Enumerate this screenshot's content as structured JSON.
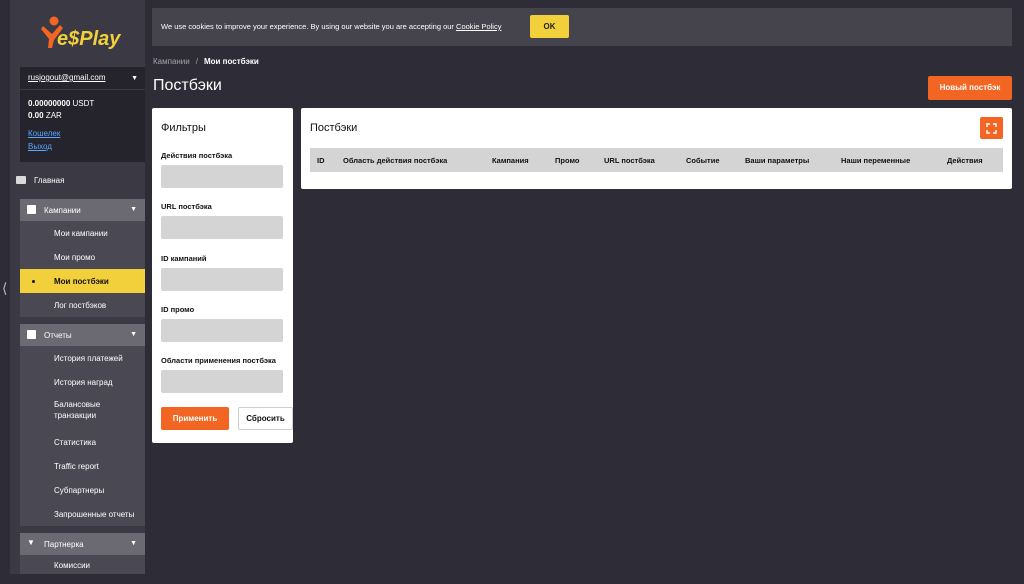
{
  "brand": {
    "logo_text": "Ye$Play",
    "accent": "#f26522",
    "highlight": "#f2d03b"
  },
  "account": {
    "email": "rusjogout@gmail.com",
    "balance_usdt_value": "0.00000000",
    "balance_usdt_currency": "USDT",
    "balance_zar_value": "0.00",
    "balance_zar_currency": "ZAR",
    "wallet_link": "Кошелек",
    "logout_link": "Выход"
  },
  "sidebar": {
    "home": "Главная",
    "campaigns": {
      "label": "Кампании",
      "items": [
        "Мои кампании",
        "Мои промо",
        "Мои постбэки",
        "Лог постбэков"
      ]
    },
    "reports": {
      "label": "Отчеты",
      "items": [
        "История платежей",
        "История наград",
        "Балансовые транзакции",
        "Статистика",
        "Traffic report",
        "Субпартнеры",
        "Запрошенные отчеты"
      ]
    },
    "partner": {
      "label": "Партнерка",
      "items": [
        "Комиссии"
      ]
    }
  },
  "cookie": {
    "text": "We use cookies to improve your experience. By using our website you are accepting our",
    "link": "Cookie Policy",
    "ok": "OK"
  },
  "breadcrumb": {
    "parent": "Кампании",
    "sep": "/",
    "current": "Мои постбэки"
  },
  "page": {
    "title": "Постбэки",
    "new_button": "Новый постбэк"
  },
  "filters": {
    "title": "Фильтры",
    "fields": [
      "Действия постбэка",
      "URL постбэка",
      "ID кампаний",
      "ID промо",
      "Области применения постбэка"
    ],
    "apply": "Применить",
    "reset": "Сбросить"
  },
  "postbacks": {
    "title": "Постбэки",
    "columns": [
      "ID",
      "Область действия постбэка",
      "Кампания",
      "Промо",
      "URL постбэка",
      "Событие",
      "Ваши параметры",
      "Наши переменные",
      "Действия"
    ]
  }
}
